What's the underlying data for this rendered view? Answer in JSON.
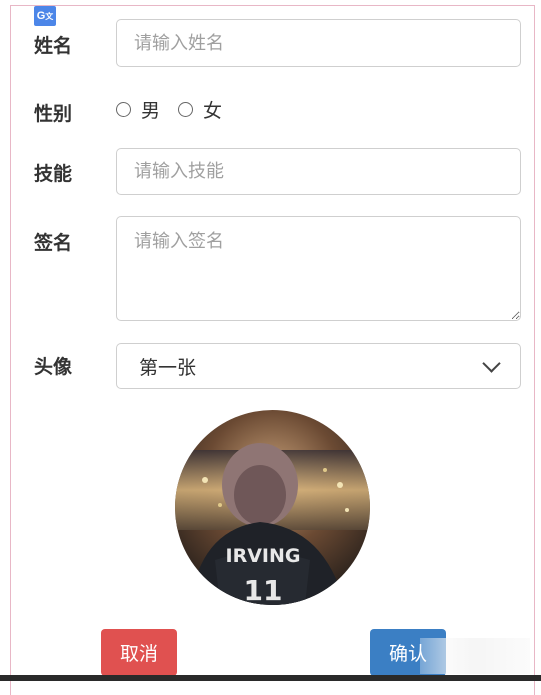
{
  "form": {
    "name": {
      "label": "姓名",
      "placeholder": "请输入姓名"
    },
    "gender": {
      "label": "性别",
      "options": [
        "男",
        "女"
      ]
    },
    "skill": {
      "label": "技能",
      "placeholder": "请输入技能"
    },
    "signature": {
      "label": "签名",
      "placeholder": "请输入签名"
    },
    "avatar": {
      "label": "头像",
      "selected": "第一张",
      "jersey_name": "IRVING",
      "jersey_number": "11"
    }
  },
  "buttons": {
    "cancel": "取消",
    "confirm": "确认"
  },
  "colors": {
    "cancel": "#e05150",
    "confirm": "#3b7fc4",
    "border": "#e8b7c6"
  },
  "icons": {
    "translate": "google-translate-icon"
  }
}
